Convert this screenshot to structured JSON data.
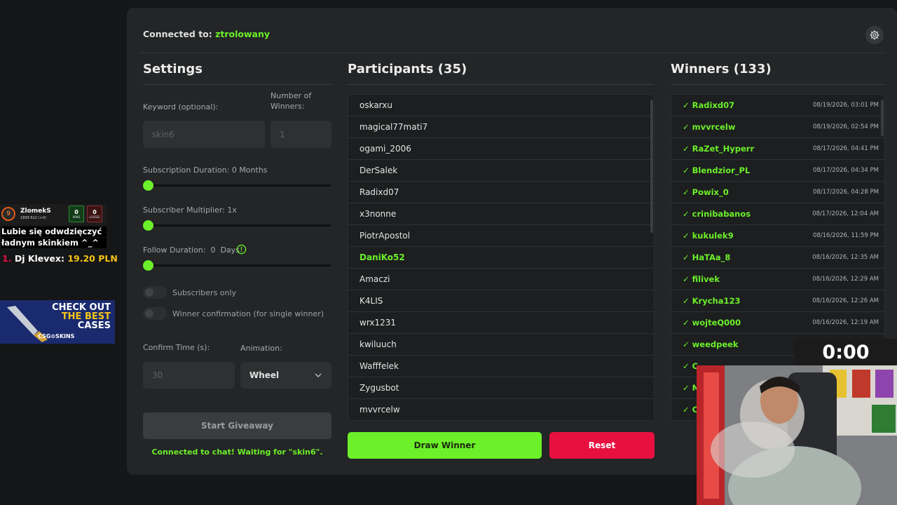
{
  "header": {
    "connected_label": "Connected to:",
    "channel": "ztrolowany"
  },
  "settings": {
    "title": "Settings",
    "keyword_label": "Keyword (optional):",
    "keyword_value": "skin6",
    "winners_label_1": "Number of",
    "winners_label_2": "Winners:",
    "winners_value": "1",
    "sub_duration_label": "Subscription Duration: 0 Months",
    "sub_multiplier_label": "Subscriber Multiplier: 1x",
    "follow_duration_label": "Follow Duration:  0  Days",
    "subscribers_only_label": "Subscribers only",
    "winner_confirm_label": "Winner confirmation (for single winner)",
    "confirm_time_label": "Confirm Time (s):",
    "confirm_time_value": "30",
    "animation_label": "Animation:",
    "animation_value": "Wheel",
    "start_button": "Start Giveaway",
    "status": "Connected to chat! Waiting for \"skin6\"."
  },
  "participants": {
    "title": "Participants (35)",
    "items": [
      "oskarxu",
      "magical77mati7",
      "ogami_2006",
      "DerSalek",
      "Radixd07",
      "x3nonne",
      "PiotrApostol",
      "DaniKo52",
      "Amaczi",
      "K4LIS",
      "wrx1231",
      "kwiluuch",
      "Wafffelek",
      "Zygusbot",
      "mvvrcelw"
    ],
    "highlighted_index": 7,
    "draw_button": "Draw Winner",
    "reset_button": "Reset"
  },
  "winners": {
    "title": "Winners (133)",
    "items": [
      {
        "name": "✓ Radixd07",
        "date": "08/19/2026, 03:01 PM"
      },
      {
        "name": "✓ mvvrcelw",
        "date": "08/19/2026, 02:54 PM"
      },
      {
        "name": "✓ RaZet_Hyperr",
        "date": "08/17/2026, 04:41 PM"
      },
      {
        "name": "✓ Blendzior_PL",
        "date": "08/17/2026, 04:34 PM"
      },
      {
        "name": "✓ Powix_0",
        "date": "08/17/2026, 04:28 PM"
      },
      {
        "name": "✓ crinibabanos",
        "date": "08/17/2026, 12:04 AM"
      },
      {
        "name": "✓ kukulek9",
        "date": "08/16/2026, 11:59 PM"
      },
      {
        "name": "✓ HaTAa_8",
        "date": "08/16/2026, 12:35 AM"
      },
      {
        "name": "✓ filivek",
        "date": "08/16/2026, 12:29 AM"
      },
      {
        "name": "✓ Krycha123",
        "date": "08/16/2026, 12:26 AM"
      },
      {
        "name": "✓ wojteQ000",
        "date": "08/16/2026, 12:19 AM"
      },
      {
        "name": "✓ weedpeek",
        "date": ""
      },
      {
        "name": "✓ C",
        "date": ""
      },
      {
        "name": "✓ M",
        "date": ""
      },
      {
        "name": "✓ C",
        "date": ""
      }
    ]
  },
  "overlay": {
    "player_name": "ZlomekS",
    "player_elo": "1899 ELO (+0)",
    "player_level": "9",
    "wins_value": "0",
    "wins_label": "WINS",
    "losses_value": "0",
    "losses_label": "LOSSES",
    "chat_line_1": "Lubie się odwdzięczyć",
    "chat_line_2": "ładnym skinkiem ^_^",
    "donor_rank": "1.",
    "donor_name": "Dj Klevex:",
    "donor_amount": "19.20 PLN",
    "ad_line_1": "CHECK OUT",
    "ad_line_2": "THE BEST",
    "ad_line_3": "CASES",
    "ad_brand": "CSG⊙SKINS",
    "timer": "0:00"
  },
  "colors": {
    "accent": "#6cf02a",
    "danger": "#e8103f",
    "panel": "#232526",
    "background": "#151617"
  }
}
